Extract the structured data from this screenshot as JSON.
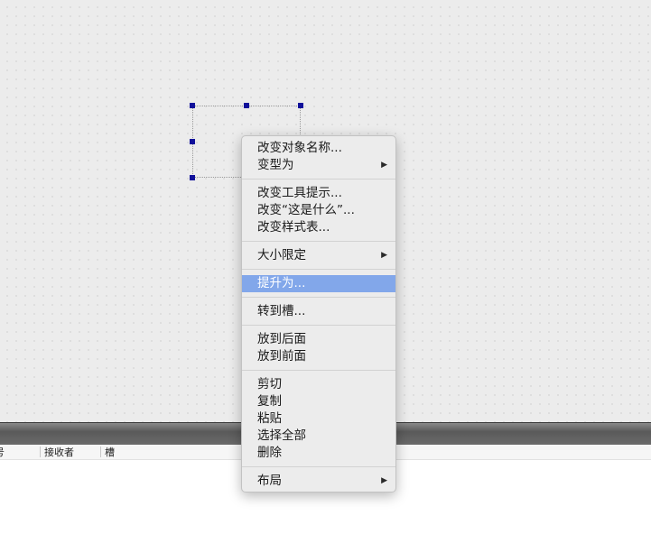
{
  "canvas": {
    "background": "#ececec",
    "handle_color": "#10109a"
  },
  "signal_panel": {
    "columns": [
      "信号",
      "接收者",
      "槽"
    ],
    "column_visible_text": [
      "号",
      "接收者",
      "槽"
    ]
  },
  "context_menu": {
    "highlight_color": "#82a7ea",
    "items": [
      {
        "label": "改变对象名称...",
        "submenu": false
      },
      {
        "label": "变型为",
        "submenu": true,
        "submenu_icon": "triangle-right-icon"
      },
      {
        "label": "改变工具提示...",
        "submenu": false
      },
      {
        "label": "改变“这是什么”...",
        "submenu": false
      },
      {
        "label": "改变样式表...",
        "submenu": false
      },
      {
        "label": "大小限定",
        "submenu": true,
        "submenu_icon": "triangle-right-icon"
      },
      {
        "label": "提升为...",
        "submenu": false,
        "highlighted": true
      },
      {
        "label": "转到槽...",
        "submenu": false
      },
      {
        "label": "放到后面",
        "submenu": false
      },
      {
        "label": "放到前面",
        "submenu": false
      },
      {
        "label": "剪切",
        "submenu": false
      },
      {
        "label": "复制",
        "submenu": false
      },
      {
        "label": "粘贴",
        "submenu": false
      },
      {
        "label": "选择全部",
        "submenu": false
      },
      {
        "label": "删除",
        "submenu": false
      },
      {
        "label": "布局",
        "submenu": true,
        "submenu_icon": "triangle-right-icon"
      }
    ]
  }
}
